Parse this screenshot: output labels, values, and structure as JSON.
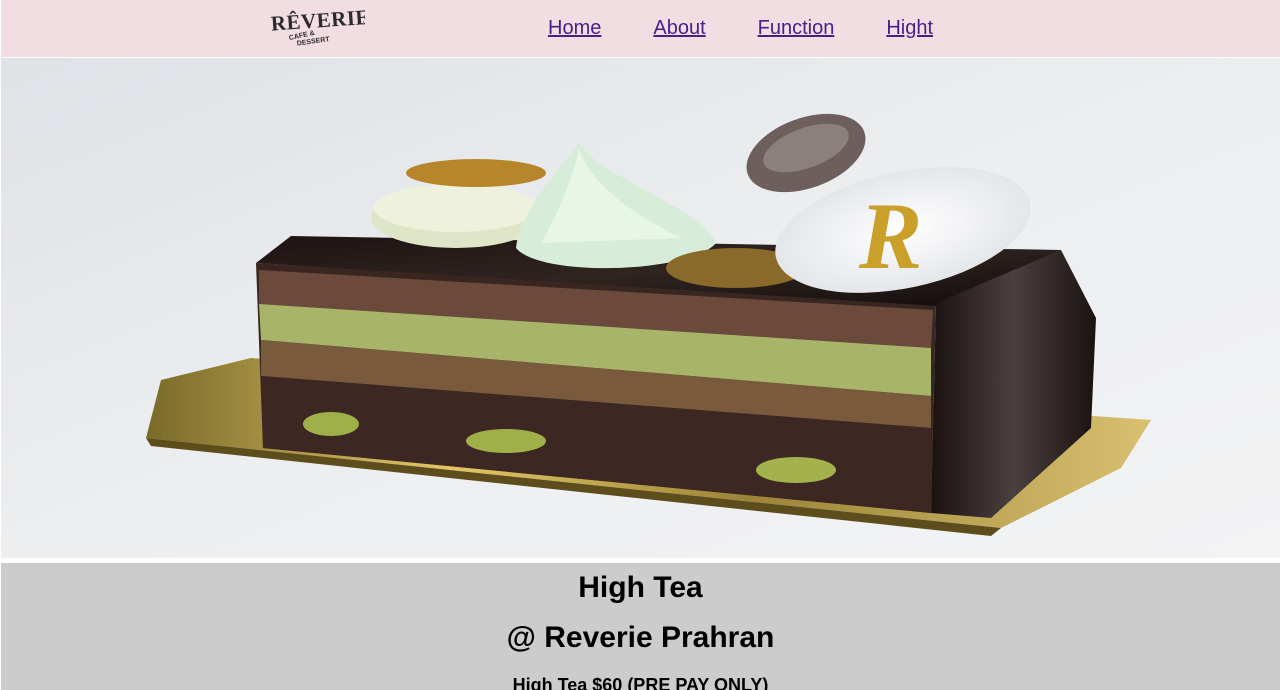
{
  "brand": {
    "logo_text": "RÊVERIE",
    "logo_subtext": "CAFE & DESSERT"
  },
  "nav": {
    "items": [
      {
        "label": "Home"
      },
      {
        "label": "About"
      },
      {
        "label": "Function"
      },
      {
        "label": "Hight"
      }
    ],
    "link_color": "#4b1e87",
    "background": "#f2dde2"
  },
  "hero": {
    "image": "cake-icon",
    "plaque_letter": "R"
  },
  "info": {
    "title": "High Tea",
    "location": "@ Reverie Prahran",
    "price_line": "High Tea $60 (PRE PAY ONLY)",
    "background": "#cccccc"
  }
}
